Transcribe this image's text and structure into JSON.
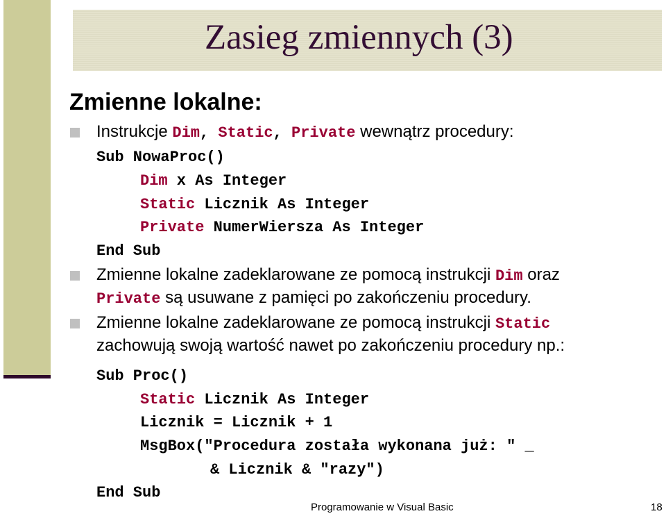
{
  "slide": {
    "title": "Zasieg zmiennych (3)",
    "heading": "Zmienne lokalne:",
    "colors": {
      "sidebar": "#cccc99",
      "title_band": "#e4e2cc",
      "title_text": "#330d33",
      "keyword": "#990033",
      "bullet": "#c0c0c0"
    },
    "bullet1": {
      "prefix": "Instrukcje ",
      "kw1": "Dim",
      "sep1": ", ",
      "kw2": "Static",
      "sep2": ", ",
      "kw3": "Private",
      "suffix": " wewnątrz procedury:"
    },
    "code1": {
      "line1": "Sub NowaProc()",
      "line2_kw": "Dim",
      "line2_rest": " x As Integer",
      "line3_kw": "Static",
      "line3_rest": " Licznik As Integer",
      "line4_kw": "Private",
      "line4_rest": " NumerWiersza As Integer",
      "line5": "End Sub"
    },
    "bullet2": {
      "text1": "Zmienne lokalne zadeklarowane ze pomocą instrukcji ",
      "kw1": "Dim",
      "text2": " oraz",
      "kw2": "Private",
      "text3": " są usuwane z pamięci po zakończeniu procedury."
    },
    "bullet3": {
      "text1": "Zmienne lokalne zadeklarowane ze pomocą instrukcji ",
      "kw1": "Static",
      "text2": "zachowują swoją wartość nawet po zakończeniu procedury np.:"
    },
    "code2": {
      "line1": "Sub Proc()",
      "line2_kw": "Static",
      "line2_rest": " Licznik As Integer",
      "line3": "Licznik = Licznik + 1",
      "line4": "MsgBox(″Procedura została wykonana już: ″ _",
      "line5": "& Licznik & ″razy″)",
      "line6": "End Sub"
    },
    "footer": {
      "text": "Programowanie w Visual Basic",
      "page_number": "18"
    }
  }
}
